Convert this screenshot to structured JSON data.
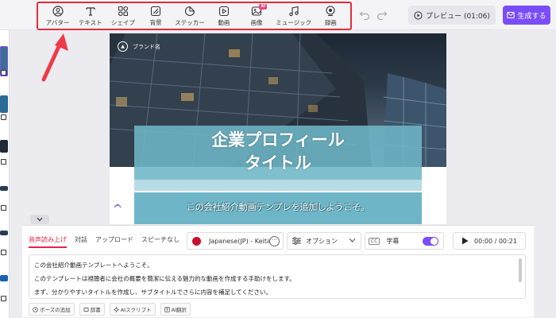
{
  "toolbar": {
    "tools": [
      {
        "label": "アバター",
        "icon": "avatar-icon"
      },
      {
        "label": "テキスト",
        "icon": "text-icon"
      },
      {
        "label": "シェイプ",
        "icon": "shape-icon"
      },
      {
        "label": "背景",
        "icon": "background-icon"
      },
      {
        "label": "ステッカー",
        "icon": "sticker-icon"
      },
      {
        "label": "動画",
        "icon": "video-icon"
      },
      {
        "label": "画像",
        "icon": "image-icon",
        "badge": "AI"
      },
      {
        "label": "ミュージック",
        "icon": "music-icon"
      },
      {
        "label": "録画",
        "icon": "record-icon"
      }
    ],
    "preview_label": "プレビュー (01:06)",
    "generate_label": "生成する"
  },
  "canvas": {
    "brand": "ブランド名",
    "title_line1": "企業プロフィール",
    "title_line2": "タイトル",
    "subtitle": "この会社紹介動画テンプレを追加しようこそ。"
  },
  "panel": {
    "tabs": [
      "音声読み上げ",
      "対話",
      "アップロード",
      "スピーチなし"
    ],
    "voice": "Japanese(JP) - Keita",
    "option_label": "オプション",
    "caption_label": "字幕",
    "caption_cc": "CC",
    "time": "00:00 / 00:21",
    "script_lines": [
      "この会社紹介動画テンプレートへようこそ。",
      "このテンプレートは視聴者に会社の概要を簡潔に伝える魅力的な動画を作成する手助けをします。",
      "まず、分かりやすいタイトルを作成し、サブタイトルでさらに内容を補足してください。"
    ],
    "bottom_tools": [
      "ポーズの追加",
      "辞書",
      "AIスクリプト",
      "AI翻訳"
    ]
  },
  "colors": {
    "highlight_border": "#e02d3c",
    "accent": "#7b4dfa",
    "active_tab": "#e0264a",
    "title_band": "#6eb6c7"
  }
}
